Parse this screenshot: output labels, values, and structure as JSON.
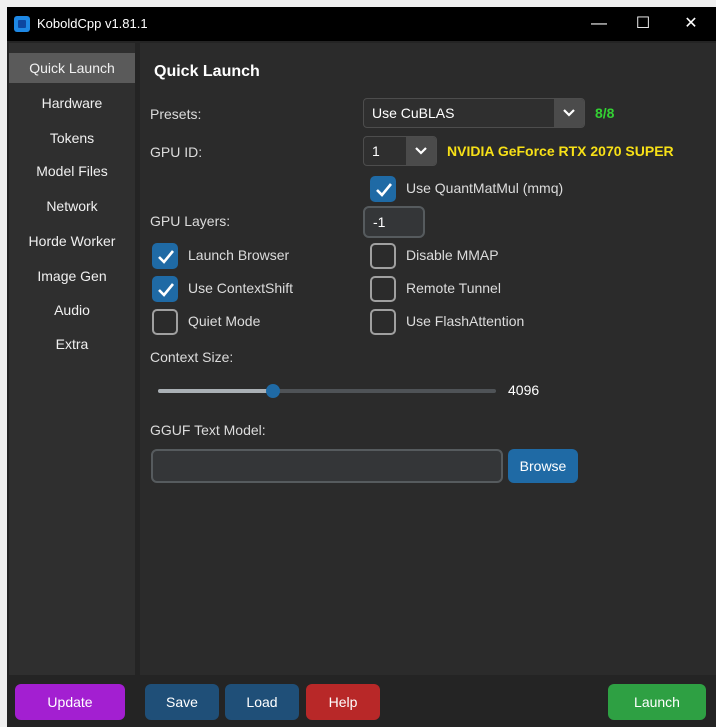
{
  "window": {
    "title": "KoboldCpp v1.81.1"
  },
  "sidebar": {
    "items": [
      {
        "label": "Quick Launch",
        "active": true
      },
      {
        "label": "Hardware"
      },
      {
        "label": "Tokens"
      },
      {
        "label": "Model Files"
      },
      {
        "label": "Network"
      },
      {
        "label": "Horde Worker"
      },
      {
        "label": "Image Gen"
      },
      {
        "label": "Audio"
      },
      {
        "label": "Extra"
      }
    ]
  },
  "main": {
    "heading": "Quick Launch",
    "presets": {
      "label": "Presets:",
      "value": "Use CuBLAS",
      "count": "8/8"
    },
    "gpu_id": {
      "label": "GPU ID:",
      "value": "1",
      "gpu_name": "NVIDIA GeForce RTX 2070 SUPER"
    },
    "quantmatmul": {
      "label": "Use QuantMatMul (mmq)",
      "checked": true
    },
    "gpu_layers": {
      "label": "GPU Layers:",
      "value": "-1"
    },
    "checkboxes_left": [
      {
        "label": "Launch Browser",
        "checked": true
      },
      {
        "label": "Use ContextShift",
        "checked": true
      },
      {
        "label": "Quiet Mode",
        "checked": false
      }
    ],
    "checkboxes_right": [
      {
        "label": "Disable MMAP",
        "checked": false
      },
      {
        "label": "Remote Tunnel",
        "checked": false
      },
      {
        "label": "Use FlashAttention",
        "checked": false
      }
    ],
    "context_size": {
      "label": "Context Size:",
      "value": "4096",
      "slider_fraction": 0.34
    },
    "gguf": {
      "label": "GGUF Text Model:",
      "value": "",
      "browse_label": "Browse"
    }
  },
  "bottom": {
    "update": "Update",
    "save": "Save",
    "load": "Load",
    "help": "Help",
    "launch": "Launch"
  },
  "colors": {
    "accent_blue": "#1f6aa5",
    "update_purple": "#a31fd1",
    "help_red": "#b82828",
    "launch_green": "#2ea043",
    "status_green": "#33d133",
    "gpu_yellow": "#f7e017"
  }
}
